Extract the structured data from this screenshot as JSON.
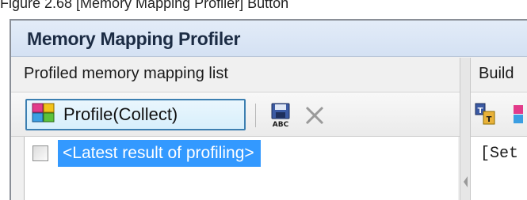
{
  "figure_caption": "Figure 2.68   [Memory Mapping Profiler] Button",
  "window": {
    "title": "Memory Mapping Profiler"
  },
  "left_pane": {
    "header": "Profiled memory mapping list",
    "toolbar": {
      "profile_button_label": "Profile(Collect)",
      "profile_icon": "profile-colored-blocks-icon",
      "save_icon": "save-abc-floppy-icon",
      "clear_icon": "clear-x-icon"
    },
    "list": {
      "items": [
        {
          "label": "<Latest result of profiling>",
          "selected": true,
          "checked": false
        }
      ]
    }
  },
  "right_pane": {
    "header": "Build",
    "toolbar_icon": "build-tool-icon",
    "content_text": "[Set"
  },
  "colors": {
    "title_bar": "#d4e1f3",
    "selection": "#3399ff",
    "button_border": "#3c7fb1"
  }
}
